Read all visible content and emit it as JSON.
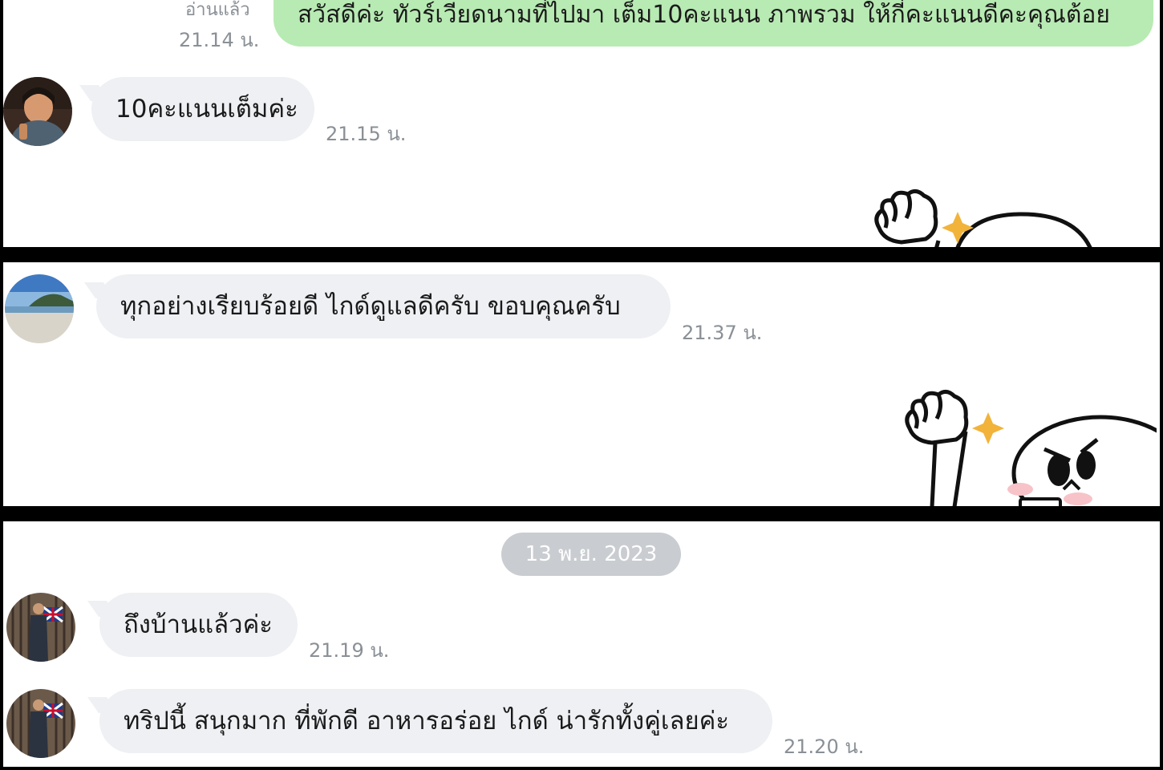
{
  "panels": [
    {
      "sent_message": {
        "text": "สวัสดีค่ะ ทัวร์เวียดนามที่ไปมา เต็ม10คะแนน ภาพรวม ให้กี่คะแนนดีคะคุณต้อย",
        "read_label": "อ่านแล้ว",
        "time": "21.14 น."
      },
      "received_message": {
        "text": "10คะแนนเต็มค่ะ",
        "time": "21.15 น.",
        "avatar": "avatar-woman-photo"
      },
      "sticker": "sticker-fist-character"
    },
    {
      "received_message": {
        "text": "ทุกอย่างเรียบร้อยดี ไกด์ดูแลดีครับ ขอบคุณครับ",
        "time": "21.37 น.",
        "avatar": "avatar-beach-photo"
      },
      "sticker": "sticker-fist-character"
    },
    {
      "date_separator": "13 พ.ย. 2023",
      "messages": [
        {
          "text": "ถึงบ้านแล้วค่ะ",
          "time": "21.19 น.",
          "avatar": "avatar-person-uk-flag"
        },
        {
          "text": "ทริปนี้ สนุกมาก ที่พักดี อาหารอร่อย ไกด์ น่ารักทั้งคู่เลยค่ะ",
          "time": "21.20 น.",
          "avatar": "avatar-person-uk-flag"
        }
      ]
    }
  ],
  "colors": {
    "sent_bubble": "#b8eab3",
    "received_bubble": "#eef0f3",
    "timestamp": "#8a9096",
    "date_chip": "#c9ccd0",
    "panel_border": "#000000"
  }
}
